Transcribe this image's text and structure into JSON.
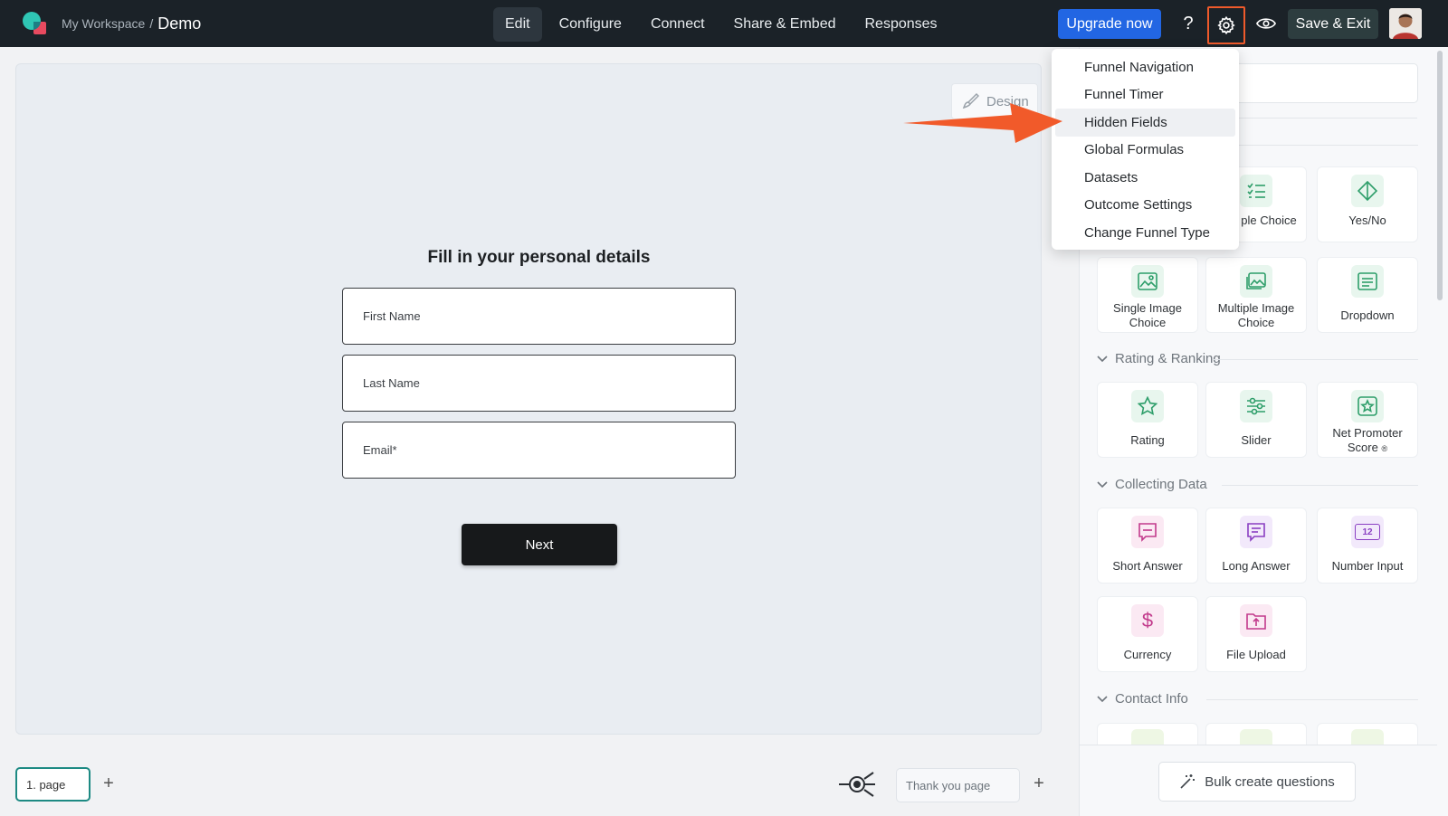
{
  "header": {
    "workspace": "My Workspace",
    "separator": "/",
    "current": "Demo",
    "tabs": [
      {
        "label": "Edit",
        "active": true
      },
      {
        "label": "Configure"
      },
      {
        "label": "Connect"
      },
      {
        "label": "Share & Embed"
      },
      {
        "label": "Responses"
      }
    ],
    "upgrade_label": "Upgrade now",
    "help_label": "?",
    "save_label": "Save & Exit",
    "accent": "#2266e3",
    "highlight_color": "#ef5a2b"
  },
  "settings_menu": {
    "items": [
      "Funnel Navigation",
      "Funnel Timer",
      "Hidden Fields",
      "Global Formulas",
      "Datasets",
      "Outcome Settings",
      "Change Funnel Type"
    ],
    "highlighted_index": 2
  },
  "canvas": {
    "design_label": "Design",
    "form_title": "Fill in your personal details",
    "fields": [
      "First Name",
      "Last Name",
      "Email*"
    ],
    "next_label": "Next"
  },
  "bottom": {
    "page_label": "1. page",
    "add": "+",
    "thank_label": "Thank you page"
  },
  "panel": {
    "choice_cards": [
      {
        "label": "ple Choice",
        "icon": "list-check-icon"
      },
      {
        "label": "Yes/No",
        "icon": "diamond-icon"
      },
      {
        "label": "Single Image Choice",
        "icon": "image-icon"
      },
      {
        "label": "Multiple Image Choice",
        "icon": "images-icon"
      },
      {
        "label": "Dropdown",
        "icon": "dropdown-icon"
      }
    ],
    "sections": {
      "rating": "Rating & Ranking",
      "collecting": "Collecting Data",
      "contact": "Contact Info"
    },
    "rating_cards": [
      {
        "label": "Rating",
        "icon": "star-icon"
      },
      {
        "label": "Slider",
        "icon": "slider-icon"
      },
      {
        "label": "Net Promoter Score",
        "icon": "nps-icon"
      }
    ],
    "collecting_cards": [
      {
        "label": "Short Answer",
        "icon": "short-answer-icon"
      },
      {
        "label": "Long Answer",
        "icon": "long-answer-icon"
      },
      {
        "label": "Number Input",
        "icon": "number-icon"
      },
      {
        "label": "Currency",
        "icon": "dollar-icon"
      },
      {
        "label": "File Upload",
        "icon": "upload-icon"
      }
    ],
    "number_icon_text": "12",
    "currency_symbol": "$",
    "nps_mark": "®",
    "bulk_label": "Bulk create questions"
  }
}
